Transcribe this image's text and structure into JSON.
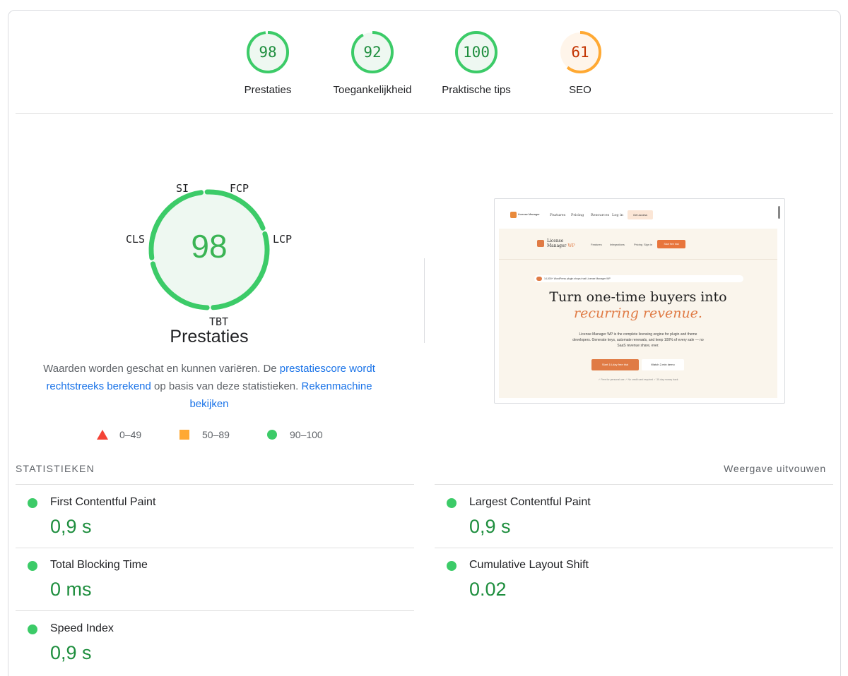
{
  "gauges": [
    {
      "label": "Prestaties",
      "score": "98",
      "value": 98,
      "status": "pass"
    },
    {
      "label": "Toegankelijkheid",
      "score": "92",
      "value": 92,
      "status": "pass"
    },
    {
      "label": "Praktische tips",
      "score": "100",
      "value": 100,
      "status": "pass"
    },
    {
      "label": "SEO",
      "score": "61",
      "value": 61,
      "status": "average"
    }
  ],
  "colors": {
    "pass": "#3ccb68",
    "pass_text": "#1e8e3e",
    "pass_bg": "#eef8f1",
    "average": "#ffa933",
    "average_text": "#c33300",
    "average_bg": "#fff5ea",
    "fail": "#f44336",
    "link": "#1a73e8"
  },
  "performance": {
    "score": "98",
    "title": "Prestaties",
    "metric_labels": {
      "si": "SI",
      "fcp": "FCP",
      "lcp": "LCP",
      "tbt": "TBT",
      "cls": "CLS"
    },
    "description": {
      "prefix": "Waarden worden geschat en kunnen variëren. De ",
      "link1": "prestatiescore wordt rechtstreeks berekend",
      "middle": " op basis van deze statistieken. ",
      "link2": "Rekenmachine bekijken"
    },
    "legend": {
      "fail": "0–49",
      "average": "50–89",
      "pass": "90–100"
    }
  },
  "screenshot": {
    "logo_text": "License Manager",
    "nav": [
      "Features",
      "Pricing",
      "Resources",
      "Log in"
    ],
    "get_access": "Get access",
    "brand_line1": "License",
    "brand_line2": "Manager",
    "brand_suffix": "WP",
    "inner_nav": [
      "Features",
      "Integrations",
      "Pricing",
      "Sign in"
    ],
    "trial_button": "Start free trial",
    "pill_text": "14,000+ WordPress plugin shops trust License Manager WP",
    "headline": "Turn one-time buyers into",
    "headline_accent": "recurring revenue.",
    "paragraph": "License Manager WP is the complete licensing engine for plugin and theme developers. Generate keys, automate renewals, and keep 100% of every sale — no SaaS revenue share, ever.",
    "cta_primary": "Start 14-day free trial",
    "cta_secondary": "Watch 2-min demo",
    "fine_print": "✓ Free for personal use   ✓ No credit card required   ✓ 30-day money back"
  },
  "statistics": {
    "title": "STATISTIEKEN",
    "expand_label": "Weergave uitvouwen",
    "metrics": [
      {
        "name": "First Contentful Paint",
        "value": "0,9 s"
      },
      {
        "name": "Largest Contentful Paint",
        "value": "0,9 s"
      },
      {
        "name": "Total Blocking Time",
        "value": "0 ms"
      },
      {
        "name": "Cumulative Layout Shift",
        "value": "0.02"
      },
      {
        "name": "Speed Index",
        "value": "0,9 s"
      }
    ]
  }
}
